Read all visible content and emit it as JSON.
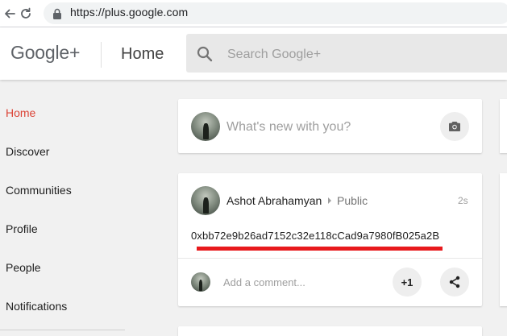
{
  "browser": {
    "url": "https://plus.google.com",
    "icons": [
      "back-arrow-icon",
      "reload-icon",
      "lock-icon"
    ]
  },
  "header": {
    "logo": "Google+",
    "page_title": "Home",
    "search_placeholder": "Search Google+",
    "search_icon": "search-icon"
  },
  "sidebar": {
    "items": [
      {
        "label": "Home",
        "active": true
      },
      {
        "label": "Discover",
        "active": false
      },
      {
        "label": "Communities",
        "active": false
      },
      {
        "label": "Profile",
        "active": false
      },
      {
        "label": "People",
        "active": false
      },
      {
        "label": "Notifications",
        "active": false
      }
    ]
  },
  "compose": {
    "placeholder": "What's new with you?",
    "camera_icon": "camera-icon"
  },
  "post": {
    "author": "Ashot Abrahamyan",
    "audience": "Public",
    "timestamp": "2s",
    "text": "0xbb72e9b26ad7152c32e118cCad9a7980fB025a2B",
    "comment_placeholder": "Add a comment...",
    "plus_one_label": "+1",
    "share_icon": "share-icon"
  },
  "colors": {
    "accent": "#db4437",
    "highlight": "#e8191c",
    "background": "#f1f1f1"
  }
}
